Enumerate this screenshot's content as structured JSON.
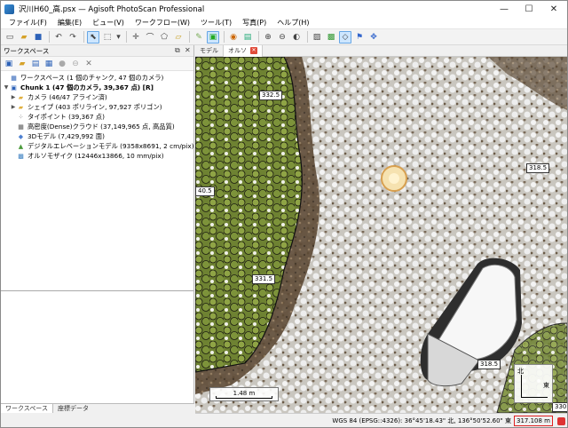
{
  "window": {
    "title": "沢川H60_高.psx — Agisoft PhotoScan Professional",
    "minimize": "—",
    "maximize": "☐",
    "close": "✕"
  },
  "menu": [
    "ファイル(F)",
    "編集(E)",
    "ビュー(V)",
    "ワークフロー(W)",
    "ツール(T)",
    "写真(P)",
    "ヘルプ(H)"
  ],
  "workspace": {
    "panel_title": "ワークスペース",
    "tree": [
      {
        "label": "ワークスペース (1 個のチャンク, 47 個のカメラ)",
        "icon": "workspace-icon",
        "level": 0,
        "bold": false
      },
      {
        "label": "Chunk 1 (47 個のカメラ, 39,367 点) [R]",
        "icon": "chunk-icon",
        "level": 0,
        "bold": true
      },
      {
        "label": "カメラ (46/47 アライン済)",
        "icon": "folder-icon",
        "level": 1,
        "bold": false
      },
      {
        "label": "シェイプ (403 ポリライン, 97,927 ポリゴン)",
        "icon": "folder-icon",
        "level": 1,
        "bold": false
      },
      {
        "label": "タイポイント (39,367 点)",
        "icon": "tiepoints-icon",
        "level": 1,
        "bold": false
      },
      {
        "label": "高密度(Dense)クラウド (37,149,965 点, 高品質)",
        "icon": "dense-cloud-icon",
        "level": 1,
        "bold": false
      },
      {
        "label": "3Dモデル (7,429,992 面)",
        "icon": "model-icon",
        "level": 1,
        "bold": false
      },
      {
        "label": "デジタルエレベーションモデル (9358x8691, 2 cm/pix)",
        "icon": "dem-icon",
        "level": 1,
        "bold": false
      },
      {
        "label": "オルソモザイク (12446x13866, 10 mm/pix)",
        "icon": "ortho-icon",
        "level": 1,
        "bold": false
      }
    ]
  },
  "bottom_tabs": [
    "ワークスペース",
    "座標データ"
  ],
  "view_tabs": [
    "モデル",
    "オルソ"
  ],
  "ortho": {
    "contour_labels": [
      "332.5",
      "318.5",
      "40.5",
      "331.5",
      "318.5",
      "330"
    ],
    "scale_text": "1.48 m",
    "compass_north": "北",
    "compass_east": "東"
  },
  "status": {
    "coords": "WGS 84 (EPSG::4326): 36°45'18.43\" 北, 136°50'52.60\" 東",
    "altitude": "317.108 m"
  },
  "colors": {
    "vegetation": "#7c8f3a",
    "snow": "#f2f2f2",
    "ground": "#5a4632",
    "highlight_border": "#e02020"
  }
}
